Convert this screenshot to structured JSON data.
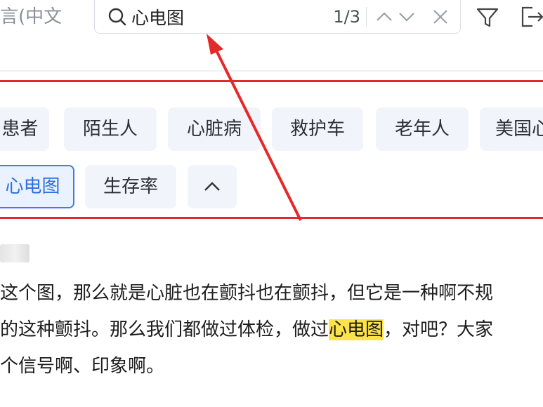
{
  "header": {
    "language_label": "言(中文",
    "search": {
      "query": "心电图",
      "match_count": "1/3"
    }
  },
  "tags": {
    "row1": [
      "患者",
      "陌生人",
      "心脏病",
      "救护车",
      "老年人",
      "美国心"
    ],
    "row2": [
      "心电图",
      "生存率"
    ],
    "active_tag": "心电图",
    "collapse_icon": "chevron-up-icon"
  },
  "transcript": {
    "lines": [
      {
        "before": "这个图，那么就是心脏也在颤抖也在颤抖，但它是一种啊不规",
        "highlight": "",
        "after": ""
      },
      {
        "before": "的这种颤抖。那么我们都做过体检，做过",
        "highlight": "心电图",
        "after": "，对吧？大家"
      },
      {
        "before": "个信号啊、印象啊。",
        "highlight": "",
        "after": ""
      }
    ]
  },
  "colors": {
    "annotation_red": "#e22a2a",
    "highlight": "#fde34a",
    "active_tag_border": "#3f7de8"
  },
  "icons": [
    "search-icon",
    "chevron-up-icon",
    "chevron-down-icon",
    "close-icon",
    "filter-icon",
    "exit-icon"
  ]
}
